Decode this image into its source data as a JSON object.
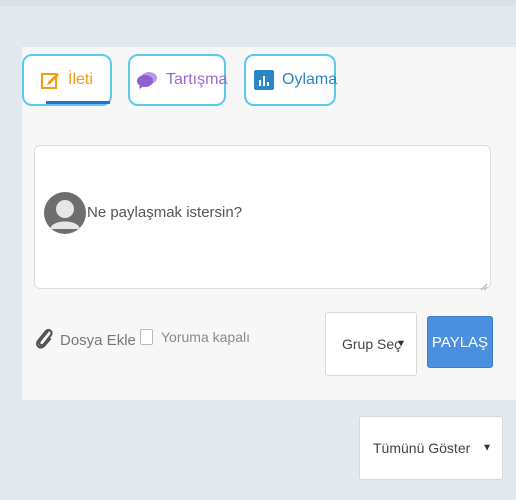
{
  "tabs": {
    "post_label": "İleti",
    "discussion_label": "Tartışma",
    "poll_label": "Oylama"
  },
  "composer": {
    "placeholder": "Ne paylaşmak istersin?"
  },
  "actions": {
    "attach_label": "Dosya Ekle",
    "comments_closed_label": "Yoruma kapalı",
    "group_select_value": "Grup Seç",
    "share_label": "PAYLAŞ"
  },
  "filter": {
    "show_all_value": "Tümünü Göster"
  },
  "colors": {
    "accent_border": "#5bc8ee",
    "post_orange": "#f29b13",
    "discussion_purple": "#9a6bd6",
    "poll_blue": "#2b86c5",
    "share_button": "#4a8fe0"
  }
}
